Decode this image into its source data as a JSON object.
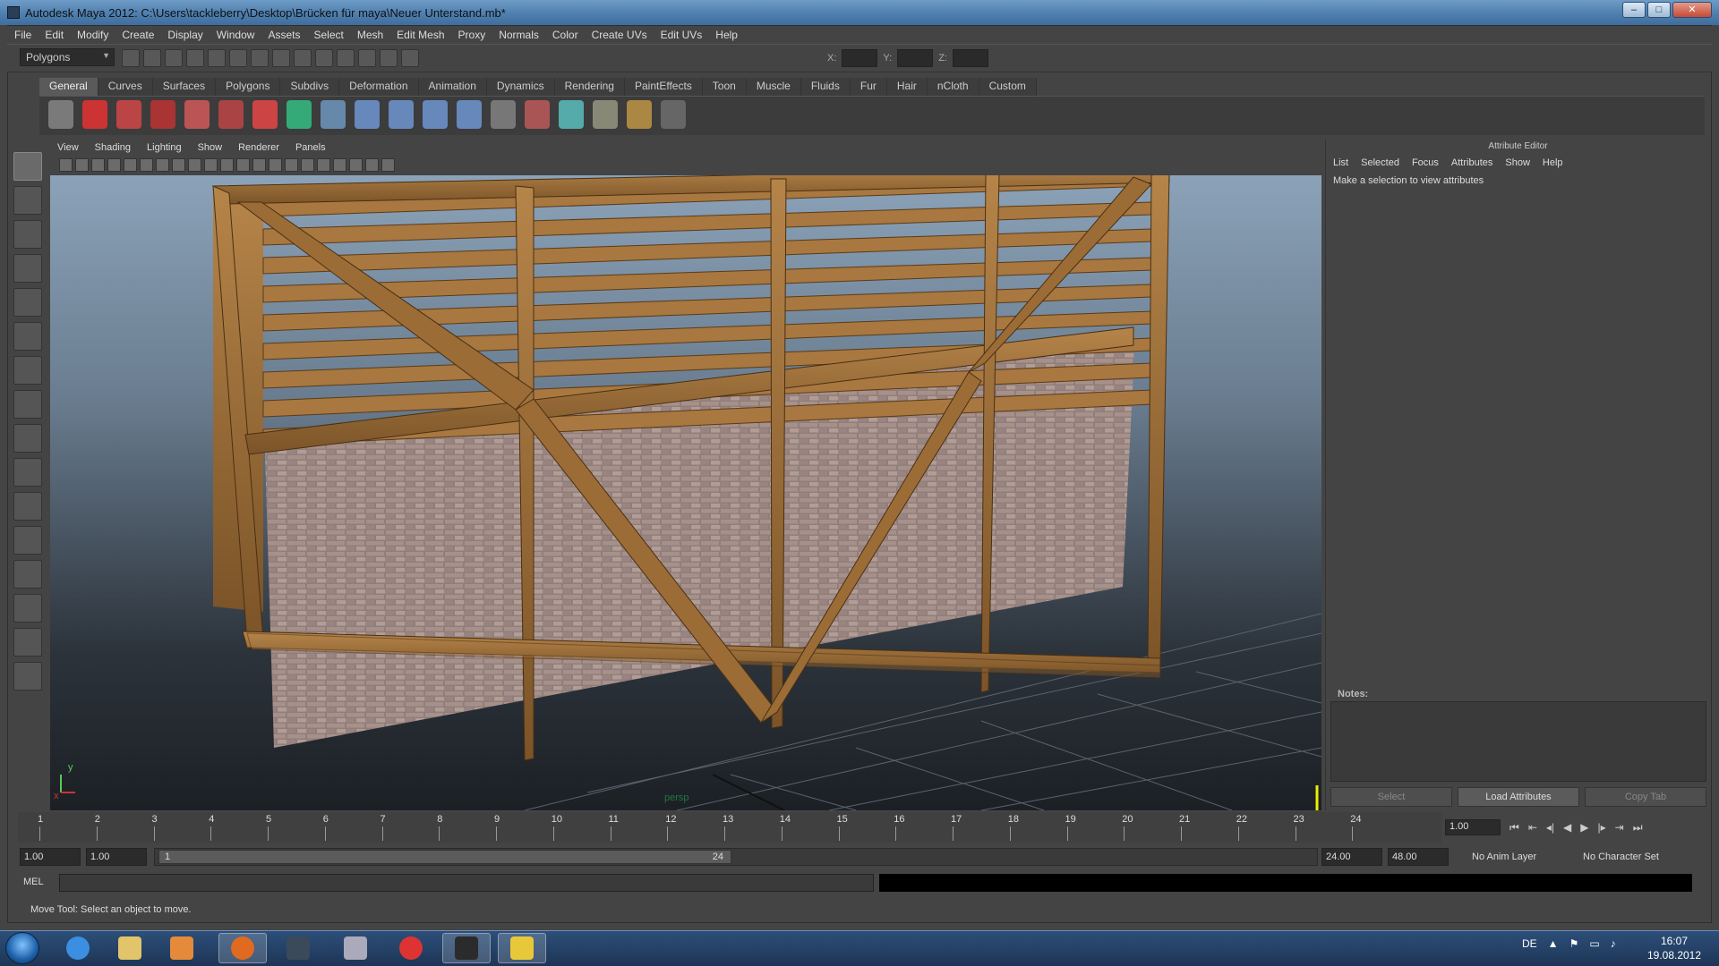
{
  "window": {
    "title": "Autodesk Maya 2012: C:\\Users\\tackleberry\\Desktop\\Brücken für maya\\Neuer Unterstand.mb*"
  },
  "menubar": [
    "File",
    "Edit",
    "Modify",
    "Create",
    "Display",
    "Window",
    "Assets",
    "Select",
    "Mesh",
    "Edit Mesh",
    "Proxy",
    "Normals",
    "Color",
    "Create UVs",
    "Edit UVs",
    "Help"
  ],
  "statusline": {
    "mode": "Polygons",
    "x_label": "X:",
    "y_label": "Y:",
    "z_label": "Z:"
  },
  "shelf_tabs": [
    "General",
    "Curves",
    "Surfaces",
    "Polygons",
    "Subdivs",
    "Deformation",
    "Animation",
    "Dynamics",
    "Rendering",
    "PaintEffects",
    "Toon",
    "Muscle",
    "Fluids",
    "Fur",
    "Hair",
    "nCloth",
    "Custom"
  ],
  "shelf_active": "General",
  "panel_menu": [
    "View",
    "Shading",
    "Lighting",
    "Show",
    "Renderer",
    "Panels"
  ],
  "viewport": {
    "camera": "persp",
    "axis_x": "x",
    "axis_y": "y"
  },
  "attribute_editor": {
    "title": "Attribute Editor",
    "menu": [
      "List",
      "Selected",
      "Focus",
      "Attributes",
      "Show",
      "Help"
    ],
    "message": "Make a selection to view attributes",
    "notes_label": "Notes:",
    "buttons": {
      "select": "Select",
      "load": "Load Attributes",
      "copy": "Copy Tab"
    }
  },
  "timeslider": {
    "ticks": [
      "1",
      "2",
      "3",
      "4",
      "5",
      "6",
      "7",
      "8",
      "9",
      "10",
      "11",
      "12",
      "13",
      "14",
      "15",
      "16",
      "17",
      "18",
      "19",
      "20",
      "21",
      "22",
      "23",
      "24"
    ],
    "current_frame": "1.00"
  },
  "range": {
    "start": "1.00",
    "playback_start": "1.00",
    "slider_start": "1",
    "slider_end": "24",
    "playback_end": "24.00",
    "end": "48.00",
    "anim_layer": "No Anim Layer",
    "character_set": "No Character Set"
  },
  "commandline": {
    "label": "MEL"
  },
  "helpline": "Move Tool: Select an object to move.",
  "taskbar": {
    "language": "DE",
    "time": "16:07",
    "date": "19.08.2012"
  },
  "colors": {
    "wood": "#9a6a35",
    "brick": "#9c8a86",
    "sky_top": "#8ba2b8",
    "accent": "#5a5a5a"
  }
}
